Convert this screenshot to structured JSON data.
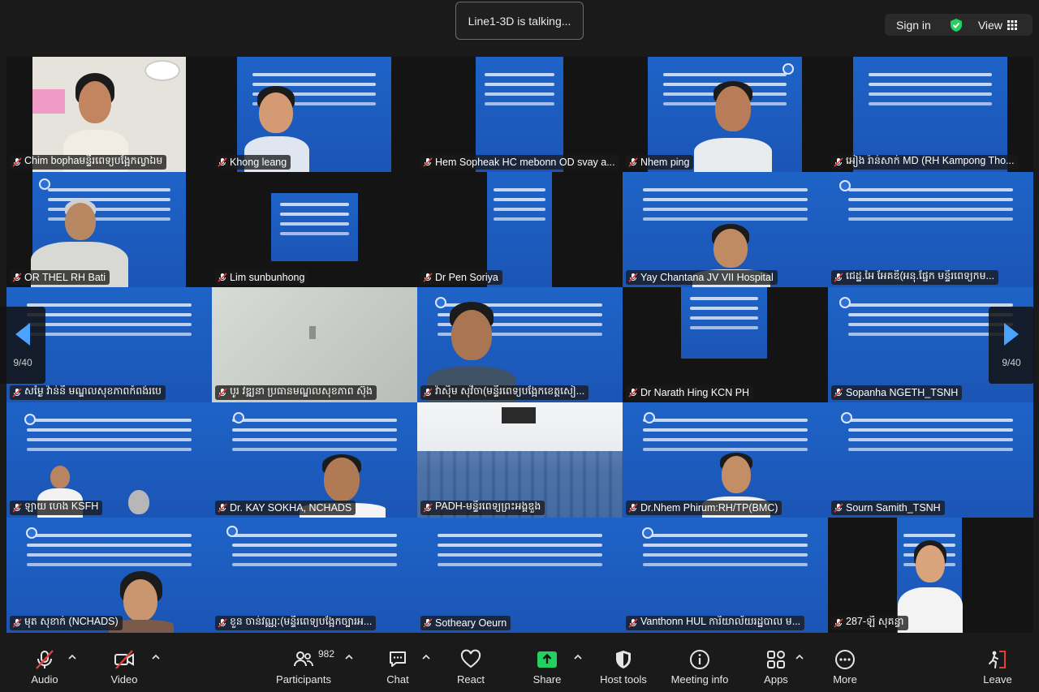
{
  "top": {
    "talking": "Line1-3D is talking...",
    "sign_in": "Sign in",
    "view": "View"
  },
  "pager": {
    "left": "9/40",
    "right": "9/40"
  },
  "tiles": [
    "Chim bophaមន្ទីរពេទ្យបង្អែកល្វាឯម",
    "Khong leang",
    "Hem Sopheak HC mebonn OD svay a...",
    "Nhem ping",
    "អៀង រ៉ាន់សាក់ MD (RH Kampong Tho...",
    "OR THEL RH Bati",
    "Lim sunbunhong",
    "Dr Pen Soriya",
    "Yay Chantana JV VII Hospital",
    "ជេដ្ឋ.អៃ អែគឌី(អនុ.ផ្នែក មន្ទីរពេទ្យកម...",
    "សម្ងៃ វ៉ាន់នី មណ្ឌលសុខភាពកំពង់របេ",
    "បូរ វឌ្ឍនា ប្រធានមណ្ឌលសុខភាព ស៊ុង",
    "វ៉ាសុិម សុវិចា(មន្ទីរពេទ្យបង្អែកខេត្តសៀ...",
    "Dr Narath Hing KCN PH",
    "Sopanha NGETH_TSNH",
    "ឡាយ ហេង KSFH",
    "Dr. KAY SOKHA, NCHADS",
    "PADH-មន្ទីរពេទ្យព្រះអង្គឌួង",
    "Dr.Nhem Phirum:RH/TP(BMC)",
    "Sourn Samith_TSNH",
    "មុត សុខាក់ (NCHADS)",
    "ខួន ចាន់វណ្ណៈ(មន្ទីរពេទ្យបង្អែកច្បារអ...",
    "Sotheary Oeurn",
    "Vanthonn HUL ការិយាល័យរដ្ឋបាល ម...",
    "287-ឡី សុគន្ធា"
  ],
  "toolbar": {
    "audio": "Audio",
    "video": "Video",
    "participants": "Participants",
    "participant_count": "982",
    "chat": "Chat",
    "react": "React",
    "share": "Share",
    "host_tools": "Host tools",
    "meeting_info": "Meeting info",
    "apps": "Apps",
    "more": "More",
    "leave": "Leave"
  },
  "colors": {
    "share_green": "#23d160",
    "mute_red": "#e0403b",
    "arrow_blue": "#4aa3ff",
    "slide_blue": "#1e63c7"
  }
}
